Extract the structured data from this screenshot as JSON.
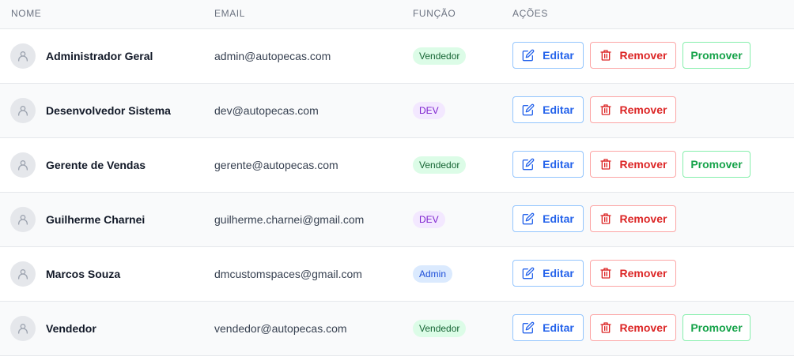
{
  "header": {
    "name": "NOME",
    "email": "EMAIL",
    "role": "FUNÇÃO",
    "actions": "AÇÕES"
  },
  "labels": {
    "edit": "Editar",
    "remove": "Remover",
    "promote": "Promover"
  },
  "colors": {
    "edit": "#2563eb",
    "remove": "#dc2626",
    "promote": "#16a34a"
  },
  "users": [
    {
      "name": "Administrador Geral",
      "email": "admin@autopecas.com",
      "role": "Vendedor",
      "role_kind": "vendedor",
      "can_promote": true
    },
    {
      "name": "Desenvolvedor Sistema",
      "email": "dev@autopecas.com",
      "role": "DEV",
      "role_kind": "dev",
      "can_promote": false
    },
    {
      "name": "Gerente de Vendas",
      "email": "gerente@autopecas.com",
      "role": "Vendedor",
      "role_kind": "vendedor",
      "can_promote": true
    },
    {
      "name": "Guilherme Charnei",
      "email": "guilherme.charnei@gmail.com",
      "role": "DEV",
      "role_kind": "dev",
      "can_promote": false
    },
    {
      "name": "Marcos Souza",
      "email": "dmcustomspaces@gmail.com",
      "role": "Admin",
      "role_kind": "admin",
      "can_promote": false
    },
    {
      "name": "Vendedor",
      "email": "vendedor@autopecas.com",
      "role": "Vendedor",
      "role_kind": "vendedor",
      "can_promote": true
    }
  ]
}
